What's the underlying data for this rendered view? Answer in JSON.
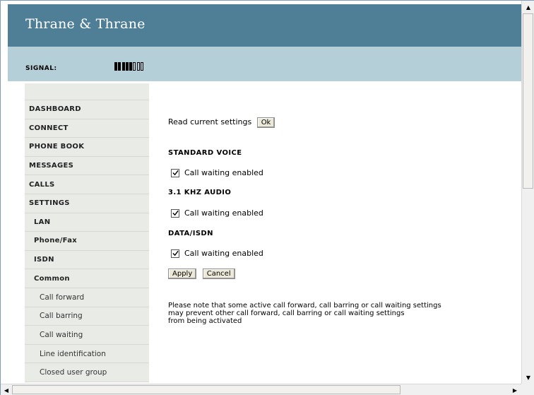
{
  "header": {
    "brand": "Thrane & Thrane"
  },
  "signal": {
    "label": "SIGNAL:",
    "level": 5,
    "max": 8
  },
  "sidebar": {
    "items": [
      {
        "label": "DASHBOARD",
        "level": 0
      },
      {
        "label": "CONNECT",
        "level": 0
      },
      {
        "label": "PHONE BOOK",
        "level": 0
      },
      {
        "label": "MESSAGES",
        "level": 0
      },
      {
        "label": "CALLS",
        "level": 0
      },
      {
        "label": "SETTINGS",
        "level": 0
      },
      {
        "label": "LAN",
        "level": 1
      },
      {
        "label": "Phone/Fax",
        "level": 1
      },
      {
        "label": "ISDN",
        "level": 1
      },
      {
        "label": "Common",
        "level": 1
      },
      {
        "label": "Call forward",
        "level": 2
      },
      {
        "label": "Call barring",
        "level": 2
      },
      {
        "label": "Call waiting",
        "level": 2
      },
      {
        "label": "Line identification",
        "level": 2
      },
      {
        "label": "Closed user group",
        "level": 2
      }
    ]
  },
  "main": {
    "read_label": "Read current settings",
    "ok_button": "Ok",
    "sections": [
      {
        "title": "STANDARD VOICE",
        "checkbox_label": "Call waiting enabled",
        "checked": true
      },
      {
        "title": "3.1 KHZ AUDIO",
        "checkbox_label": "Call waiting enabled",
        "checked": true
      },
      {
        "title": "DATA/ISDN",
        "checkbox_label": "Call waiting enabled",
        "checked": true
      }
    ],
    "apply_button": "Apply",
    "cancel_button": "Cancel",
    "note": [
      "Please note that some active call forward, call barring or call waiting settings",
      "may prevent other call forward, call barring or call waiting settings",
      "from being activated"
    ]
  },
  "colors": {
    "header": "#4e7f96",
    "signal_bar": "#b5cfd8",
    "sidebar": "#e9ece6"
  }
}
